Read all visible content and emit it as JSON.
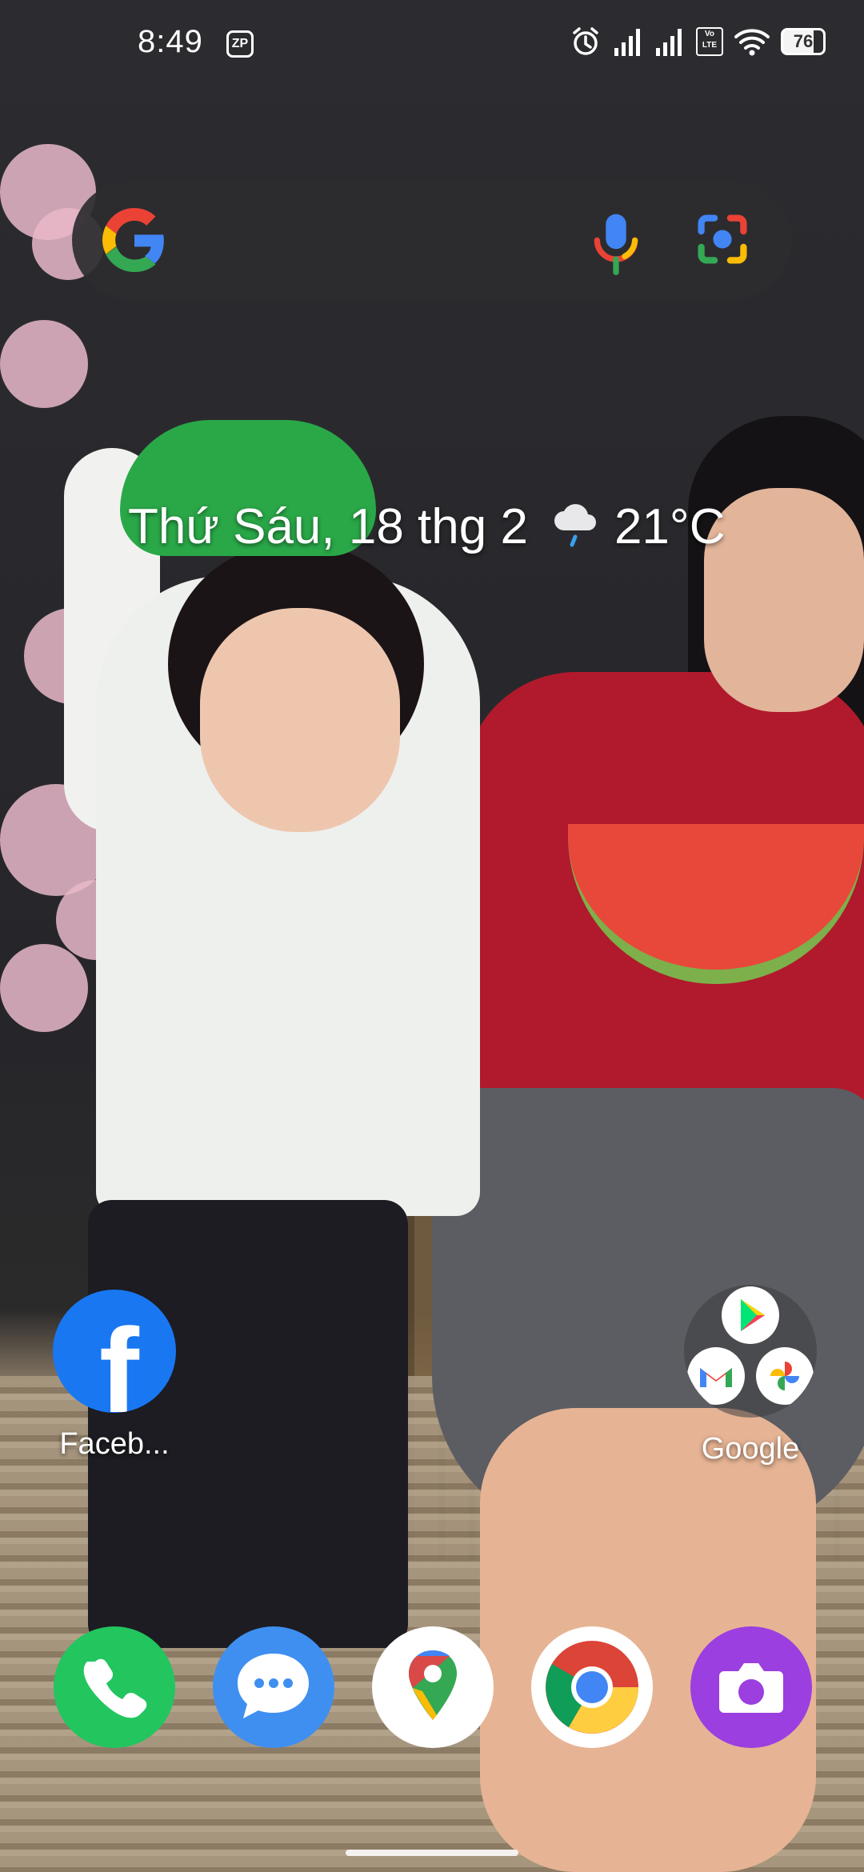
{
  "status_bar": {
    "time": "8:49",
    "notification_icon": "zp-icon",
    "battery": "76",
    "battery_level_fraction": 0.76,
    "icons": [
      "alarm-icon",
      "signal-icon",
      "signal-icon",
      "volte-icon",
      "wifi-icon",
      "battery-icon"
    ],
    "volte_text": "Vo LTE"
  },
  "search": {
    "logo": "google-g-icon",
    "mic": "mic-icon",
    "lens": "lens-icon"
  },
  "glance": {
    "date": "Thứ Sáu, 18 thg 2",
    "weather_icon": "cloud-rain-icon",
    "temperature": "21°C"
  },
  "home": {
    "apps": [
      {
        "label": "Faceb...",
        "icon": "facebook-icon",
        "color": "#1977F2"
      },
      {
        "label": "Google",
        "icon": "google-folder-icon",
        "contents": [
          "play-store-icon",
          "gmail-icon",
          "google-photos-icon"
        ]
      }
    ]
  },
  "dock": {
    "apps": [
      {
        "icon": "phone-icon",
        "color": "#22C55E"
      },
      {
        "icon": "messages-icon",
        "color": "#3F8FF0"
      },
      {
        "icon": "google-maps-icon",
        "color": "#FFFFFF"
      },
      {
        "icon": "chrome-icon",
        "color": "#FFFFFF"
      },
      {
        "icon": "camera-icon",
        "color": "#9B3FE0"
      }
    ]
  }
}
